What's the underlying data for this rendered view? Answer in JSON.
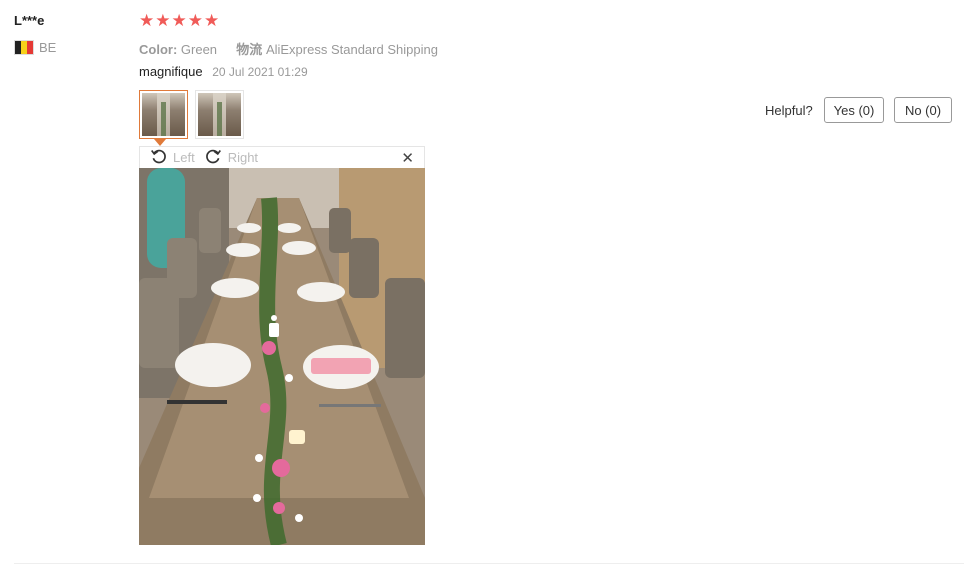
{
  "reviewer": {
    "name": "L***e",
    "country_code": "BE",
    "flag_colors": [
      "#222222",
      "#f6d11a",
      "#e53935"
    ]
  },
  "rating": {
    "stars": 5,
    "max": 5,
    "star_glyph": "★",
    "color": "#f05b58"
  },
  "attributes": {
    "color_key": "Color:",
    "color_value": "Green",
    "shipping_key": "物流",
    "shipping_value": "AliExpress Standard Shipping"
  },
  "feedback": {
    "text": "magnifique",
    "date": "20 Jul 2021 01:29"
  },
  "images": {
    "thumbnail_count": 2,
    "active_index": 0,
    "active_border_color": "#e07a3a"
  },
  "viewer": {
    "rotate_left_label": "Left",
    "rotate_right_label": "Right",
    "close_glyph": "✕"
  },
  "helpful": {
    "label": "Helpful?",
    "yes_label": "Yes (0)",
    "no_label": "No (0)"
  }
}
